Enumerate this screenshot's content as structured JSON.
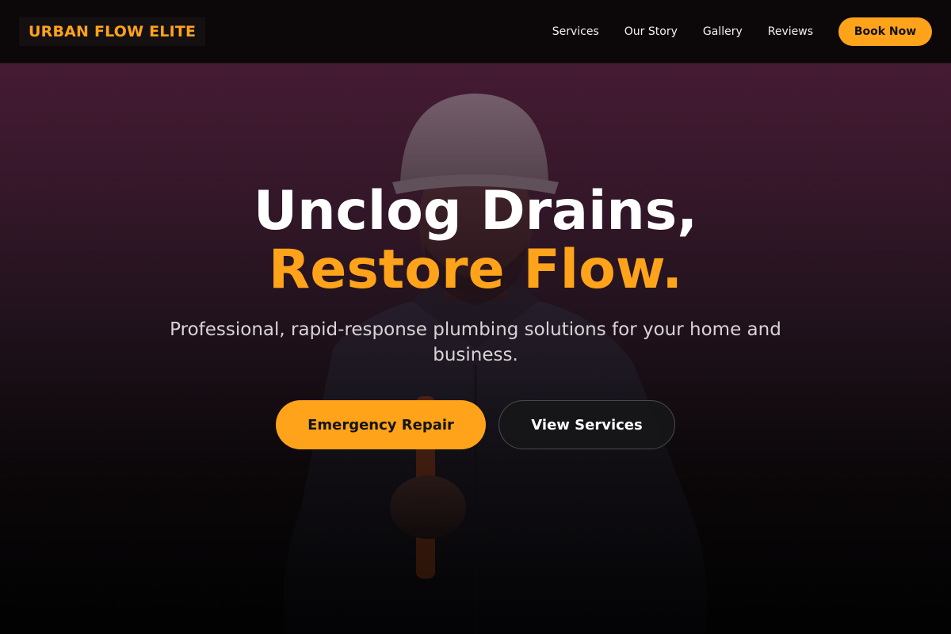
{
  "brand": {
    "name": "URBAN FLOW ELITE"
  },
  "nav": {
    "links": [
      {
        "label": "Services"
      },
      {
        "label": "Our Story"
      },
      {
        "label": "Gallery"
      },
      {
        "label": "Reviews"
      }
    ],
    "cta_label": "Book Now"
  },
  "hero": {
    "headline_line1": "Unclog Drains,",
    "headline_line2": "Restore Flow.",
    "subtitle": "Professional, rapid-response plumbing solutions for your home and business.",
    "primary_cta": "Emergency Repair",
    "secondary_cta": "View Services",
    "background_image": "plumber-with-hard-hat-photo"
  },
  "colors": {
    "accent": "#ffa31a",
    "nav_background": "#0c0709",
    "hero_top": "#471d35",
    "hero_bottom": "#040404",
    "text_primary": "#ffffff"
  }
}
